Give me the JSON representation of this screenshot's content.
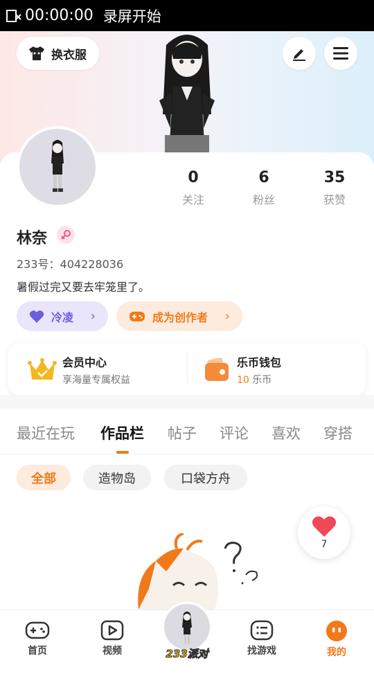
{
  "status_bar": {
    "time": "00:00:00",
    "recording": "录屏开始"
  },
  "header": {
    "change_outfit": "换衣服"
  },
  "profile": {
    "name": "林奈",
    "uid": "233号：404228036",
    "bio": "暑假过完又要去牢笼里了。",
    "stats": [
      {
        "value": "0",
        "label": "关注"
      },
      {
        "value": "6",
        "label": "粉丝"
      },
      {
        "value": "35",
        "label": "获赞"
      }
    ],
    "tag_label": "冷凌",
    "creator_label": "成为创作者"
  },
  "wallet": {
    "vip_title": "会员中心",
    "vip_sub": "享海量专属权益",
    "coin_title": "乐币钱包",
    "coin_amount": "10",
    "coin_unit": "乐币"
  },
  "tabs": [
    "最近在玩",
    "作品栏",
    "帖子",
    "评论",
    "喜欢",
    "穿搭"
  ],
  "active_tab": "作品栏",
  "subtabs": [
    "全部",
    "造物岛",
    "口袋方舟"
  ],
  "like_count": "7",
  "bottom_nav": {
    "home": "首页",
    "video": "视频",
    "center": "233派对",
    "games": "找游戏",
    "mine": "我的"
  },
  "colors": {
    "accent": "#f07a1a",
    "purple": "#6b5ce0",
    "heart": "#f0485a"
  }
}
